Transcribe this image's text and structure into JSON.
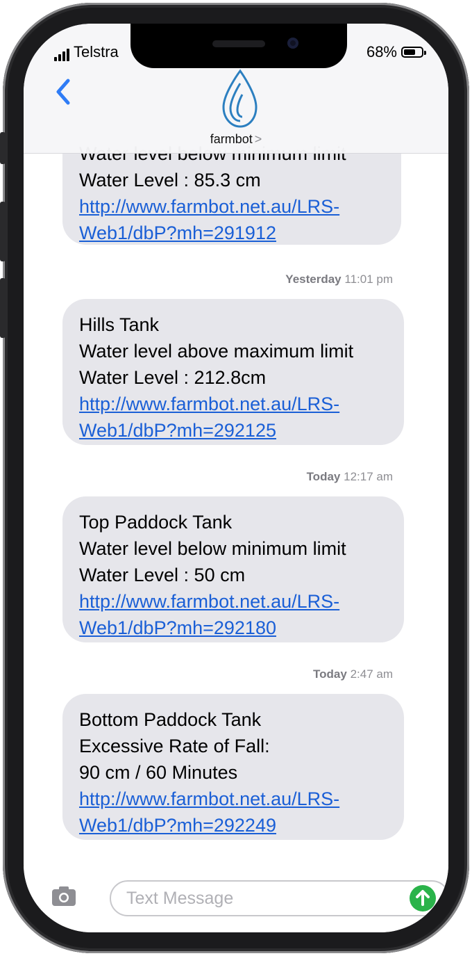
{
  "status": {
    "carrier": "Telstra",
    "battery": "68%"
  },
  "header": {
    "contact": "farmbot",
    "chevron": ">"
  },
  "messages": [
    {
      "lines": [
        "Water level below minimum limit",
        "Water Level : 85.3 cm"
      ],
      "link": [
        "http://www.farmbot.net.au/LRS-",
        "Web1/dbP?mh=291912"
      ]
    },
    {
      "lines": [
        "Hills Tank",
        "Water level above maximum limit",
        "Water Level : 212.8cm"
      ],
      "link": [
        "http://www.farmbot.net.au/LRS-",
        "Web1/dbP?mh=292125"
      ]
    },
    {
      "lines": [
        "Top Paddock Tank",
        "Water level below minimum limit",
        "Water Level : 50 cm"
      ],
      "link": [
        "http://www.farmbot.net.au/LRS-",
        "Web1/dbP?mh=292180"
      ]
    },
    {
      "lines": [
        "Bottom Paddock Tank",
        "Excessive Rate of Fall:",
        "90 cm / 60 Minutes"
      ],
      "link": [
        "http://www.farmbot.net.au/LRS-",
        "Web1/dbP?mh=292249"
      ]
    }
  ],
  "stamps": [
    {
      "day": "Yesterday",
      "time": "11:01 pm"
    },
    {
      "day": "Today",
      "time": "12:17 am"
    },
    {
      "day": "Today",
      "time": "2:47 am"
    }
  ],
  "compose": {
    "placeholder": "Text Message"
  },
  "icons": {
    "back": "chevron-left-icon",
    "logo": "water-drop-icon",
    "camera": "camera-icon",
    "send": "arrow-up-icon"
  },
  "colors": {
    "link": "#1a5fd6",
    "bubble": "#e6e6eb",
    "send": "#2ab34a",
    "back": "#2f7cf6"
  }
}
